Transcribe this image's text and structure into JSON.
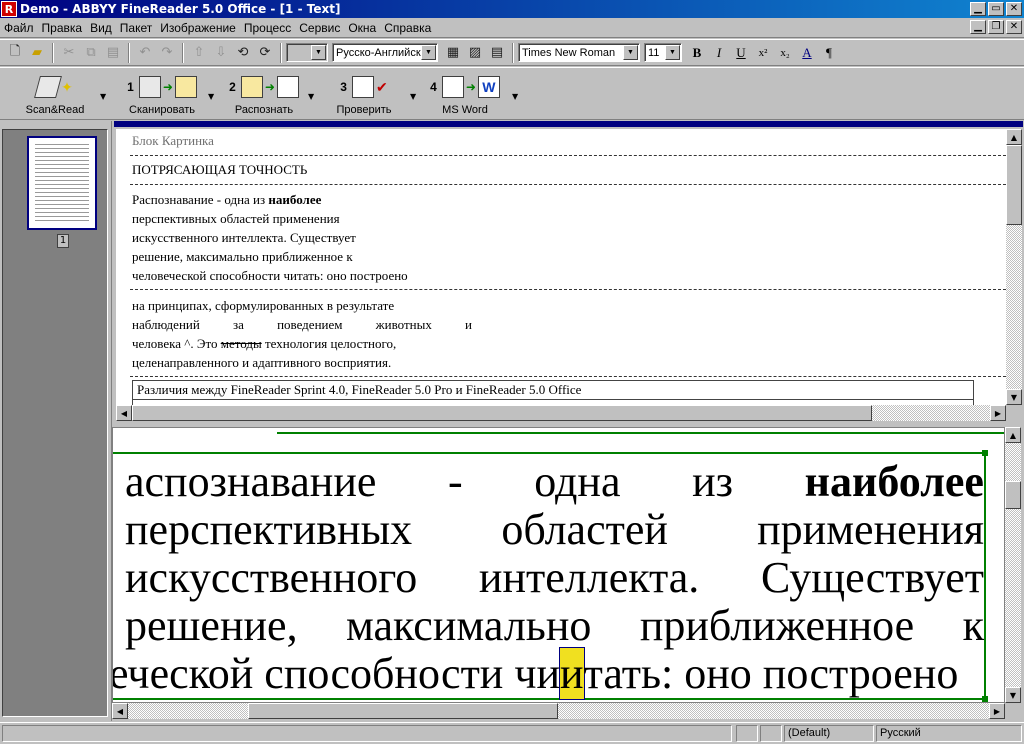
{
  "window": {
    "title": "Demo - ABBYY FineReader 5.0 Office - [1 - Text]",
    "icon_letter": "R"
  },
  "menu": [
    "Файл",
    "Правка",
    "Вид",
    "Пакет",
    "Изображение",
    "Процесс",
    "Сервис",
    "Окна",
    "Справка"
  ],
  "toolbar": {
    "language": "Русско-Английский",
    "font": "Times New Roman",
    "size": "11",
    "bold": "B",
    "italic": "I",
    "underline": "U",
    "superscript": "x²",
    "subscript": "x₂",
    "pilcrow": "¶"
  },
  "bigbar": {
    "scan_read": "Scan&Read",
    "steps": [
      {
        "num": "1",
        "label": "Сканировать"
      },
      {
        "num": "2",
        "label": "Распознать"
      },
      {
        "num": "3",
        "label": "Проверить"
      },
      {
        "num": "4",
        "label": "MS Word"
      }
    ]
  },
  "thumbnail": {
    "page_number": "1"
  },
  "document": {
    "block_label": "Блок Картинка",
    "heading": "ПОТРЯСАЮЩАЯ ТОЧНОСТЬ",
    "para1": {
      "l1a": "Распознавание - одна из ",
      "l1b": "наиболее",
      "l2": "перспективных областей применения",
      "l3": "искусственного интеллекта. Существует",
      "l4": "решение, максимально приближенное к",
      "l5": "человеческой способности читать: оно построено"
    },
    "para2": {
      "l1": "на принципах, сформулированных в результате",
      "l2w": [
        "наблюдений",
        "за",
        "поведением",
        "животных",
        "и"
      ],
      "l3a": "человека ^. Это ",
      "l3b": "методы",
      "l3c": " технология целостного,",
      "l4": "целенаправленного и адаптивного восприятия."
    },
    "table_caption": "Различия между FineReader Sprint 4.0, FineReader 5.0 Pro и FineReader 5.0 Office"
  },
  "zoom": {
    "line1": [
      "аспознавание",
      "-",
      "одна",
      "из",
      "наиболее"
    ],
    "line2": [
      "перспективных",
      "областей",
      "применения"
    ],
    "line3": [
      "искусственного",
      "интеллекта.",
      "Существует"
    ],
    "line4": [
      "решение,",
      "максимально",
      "приближенное",
      "к"
    ],
    "line5": "ечеcкой способности чи",
    "line5b": "и",
    "line5c": "тать: оно построено"
  },
  "status": {
    "style": "(Default)",
    "language": "Русский"
  }
}
